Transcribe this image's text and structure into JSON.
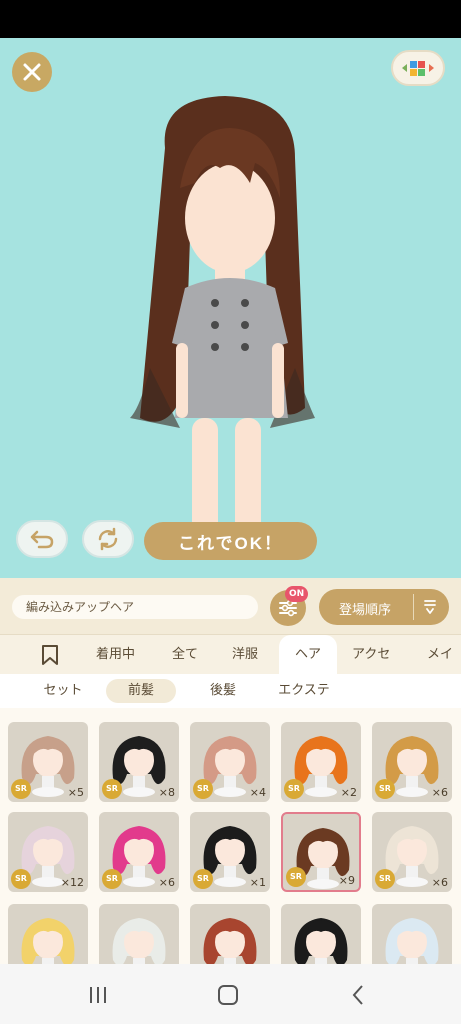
{
  "controls": {
    "ok_label": "これでOK！"
  },
  "filter_bar": {
    "item_name": "編み込みアップヘア",
    "filter_badge": "ON",
    "sort_label": "登場順序"
  },
  "category_tabs": [
    "着用中",
    "全て",
    "洋服",
    "ヘア",
    "アクセ",
    "メイク"
  ],
  "active_category": "ヘア",
  "sub_tabs": [
    "セット",
    "前髪",
    "後髪",
    "エクステ"
  ],
  "active_sub_tab": "前髪",
  "items": [
    {
      "rarity": "SR",
      "count": "×5",
      "hair_color": "#c7a08a"
    },
    {
      "rarity": "SR",
      "count": "×8",
      "hair_color": "#1e1e1e"
    },
    {
      "rarity": "SR",
      "count": "×4",
      "hair_color": "#d49a86"
    },
    {
      "rarity": "SR",
      "count": "×2",
      "hair_color": "#e8741c"
    },
    {
      "rarity": "SR",
      "count": "×6",
      "hair_color": "#d39b47"
    },
    {
      "rarity": "SR",
      "count": "×12",
      "hair_color": "#e6d3dc"
    },
    {
      "rarity": "SR",
      "count": "×6",
      "hair_color": "#e23a8c"
    },
    {
      "rarity": "SR",
      "count": "×1",
      "hair_color": "#1c1c1c"
    },
    {
      "rarity": "SR",
      "count": "×9",
      "hair_color": "#6b3a22"
    },
    {
      "rarity": "SR",
      "count": "×6",
      "hair_color": "#ede4d6"
    },
    {
      "rarity": "",
      "count": "",
      "hair_color": "#f2d26a"
    },
    {
      "rarity": "",
      "count": "",
      "hair_color": "#e9ece8"
    },
    {
      "rarity": "",
      "count": "",
      "hair_color": "#a8452f"
    },
    {
      "rarity": "",
      "count": "",
      "hair_color": "#1b1b1b"
    },
    {
      "rarity": "",
      "count": "",
      "hair_color": "#dbe9f2"
    }
  ],
  "colors": {
    "stage_bg": "#a6e3e0",
    "gold": "#c6a366",
    "badge_red": "#e8556b",
    "selected_border": "#e27c8c"
  }
}
